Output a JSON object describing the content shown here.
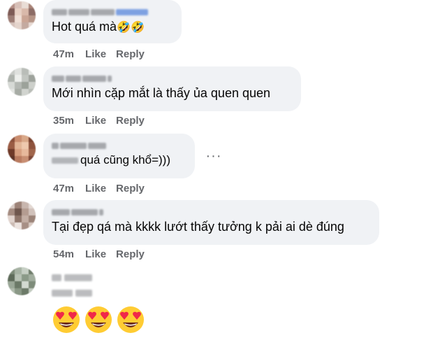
{
  "comments": [
    {
      "author_hidden": true,
      "text": "Hot quá mà",
      "emoji": "🤣🤣",
      "time": "47m",
      "like_label": "Like",
      "reply_label": "Reply"
    },
    {
      "author_hidden": true,
      "text": "Mới nhìn cặp mắt là thấy ủa quen quen",
      "time": "35m",
      "like_label": "Like",
      "reply_label": "Reply"
    },
    {
      "author_hidden": true,
      "text": "quá cũng khổ=)))",
      "time": "47m",
      "like_label": "Like",
      "reply_label": "Reply",
      "more_label": "···"
    },
    {
      "author_hidden": true,
      "text": "Tại đẹp qá mà kkkk lướt thấy tưởng k pải ai dè đúng",
      "time": "54m",
      "like_label": "Like",
      "reply_label": "Reply"
    },
    {
      "author_hidden": true,
      "emoji_count": 3,
      "emoji_name": "heart-eyes"
    }
  ],
  "colors": {
    "bubble": "#f0f2f5",
    "text": "#050505",
    "meta": "#65676b",
    "emoji_face": "#ffcc33",
    "emoji_heart": "#f02849"
  }
}
